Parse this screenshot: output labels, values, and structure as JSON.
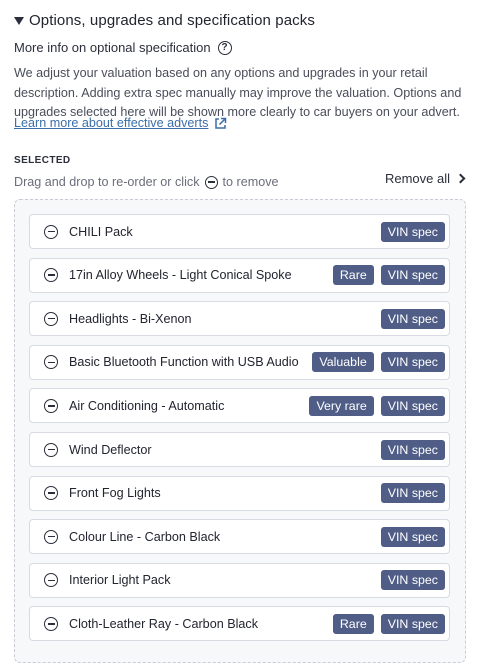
{
  "section": {
    "title": "Options, upgrades and specification packs",
    "more_info": "More info on optional specification",
    "description": "We adjust your valuation based on any options and upgrades in your retail description. Adding extra spec manually may improve the valuation. Options and upgrades selected here will be shown more clearly to car buyers on your advert.",
    "learn_more": "Learn more about effective adverts"
  },
  "selected": {
    "label": "SELECTED",
    "hint_before": "Drag and drop to re-order or click",
    "hint_after": "to remove",
    "remove_all": "Remove all",
    "items": [
      {
        "label": "CHILI Pack",
        "badges": [
          "VIN spec"
        ]
      },
      {
        "label": "17in Alloy Wheels - Light Conical Spoke",
        "badges": [
          "Rare",
          "VIN spec"
        ]
      },
      {
        "label": "Headlights - Bi-Xenon",
        "badges": [
          "VIN spec"
        ]
      },
      {
        "label": "Basic Bluetooth Function with USB Audio",
        "badges": [
          "Valuable",
          "VIN spec"
        ]
      },
      {
        "label": "Air Conditioning - Automatic",
        "badges": [
          "Very rare",
          "VIN spec"
        ]
      },
      {
        "label": "Wind Deflector",
        "badges": [
          "VIN spec"
        ]
      },
      {
        "label": "Front Fog Lights",
        "badges": [
          "VIN spec"
        ]
      },
      {
        "label": "Colour Line - Carbon Black",
        "badges": [
          "VIN spec"
        ]
      },
      {
        "label": "Interior Light Pack",
        "badges": [
          "VIN spec"
        ]
      },
      {
        "label": "Cloth-Leather Ray - Carbon Black",
        "badges": [
          "Rare",
          "VIN spec"
        ]
      }
    ]
  },
  "colors": {
    "badge_bg": "#4f5d87",
    "link": "#3b6ea8"
  }
}
